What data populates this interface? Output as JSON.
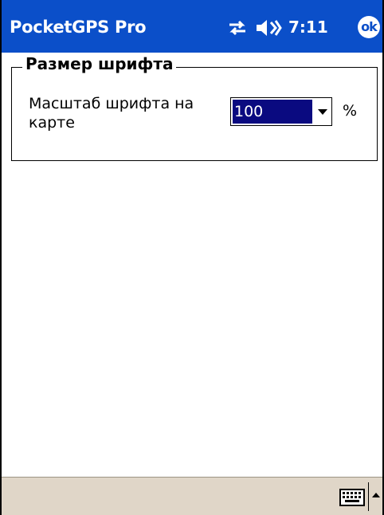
{
  "title_bar": {
    "app_title": "PocketGPS Pro",
    "clock": "7:11",
    "ok_label": "ok",
    "icons": [
      "connectivity-icon",
      "speaker-icon"
    ],
    "color": "#0b4fc9"
  },
  "group": {
    "legend": "Размер шрифта",
    "field_label": "Масштаб шрифта на карте",
    "font_scale": {
      "selected": "100",
      "unit": "%"
    }
  },
  "bottom_bar": {
    "icons": [
      "keyboard-icon",
      "sip-up-arrow-icon"
    ],
    "color": "#e0d6c8"
  }
}
